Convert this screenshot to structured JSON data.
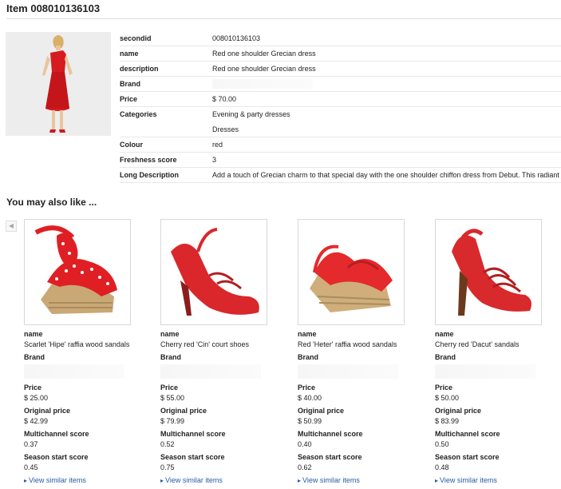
{
  "page_title": "Item 008010136103",
  "details": {
    "secondid": {
      "key": "secondid",
      "value": "008010136103"
    },
    "name": {
      "key": "name",
      "value": "Red one shoulder Grecian dress"
    },
    "description": {
      "key": "description",
      "value": "Red one shoulder Grecian dress"
    },
    "brand": {
      "key": "Brand",
      "value": ""
    },
    "price": {
      "key": "Price",
      "value": "$ 70.00"
    },
    "categories": {
      "key": "Categories",
      "value1": "Evening & party dresses",
      "value2": "Dresses"
    },
    "colour": {
      "key": "Colour",
      "value": "red"
    },
    "freshness": {
      "key": "Freshness score",
      "value": "3"
    },
    "long_description": {
      "key": "Long Description",
      "value": "Add a touch of Grecian charm to that special day with the one shoulder chiffon dress from Debut. This radiant"
    }
  },
  "recommendations_title": "You may also like ...",
  "carousel_prev_icon": "chevron-left-icon",
  "labels": {
    "name": "name",
    "brand": "Brand",
    "price": "Price",
    "original_price": "Original price",
    "multichannel": "Multichannel score",
    "season": "Season start score",
    "similar": "View similar items"
  },
  "products": [
    {
      "name": "Scarlet 'Hipe' raffia wood sandals",
      "price": "$ 25.00",
      "original_price": "$ 42.99",
      "multichannel": "0.37",
      "season": "0.45"
    },
    {
      "name": "Cherry red 'Cin' court shoes",
      "price": "$ 55.00",
      "original_price": "$ 79.99",
      "multichannel": "0.52",
      "season": "0.75"
    },
    {
      "name": "Red 'Heter' raffia wood sandals",
      "price": "$ 40.00",
      "original_price": "$ 50.99",
      "multichannel": "0.40",
      "season": "0.62"
    },
    {
      "name": "Cherry red 'Dacut' sandals",
      "price": "$ 50.00",
      "original_price": "$ 83.99",
      "multichannel": "0.50",
      "season": "0.48"
    }
  ]
}
